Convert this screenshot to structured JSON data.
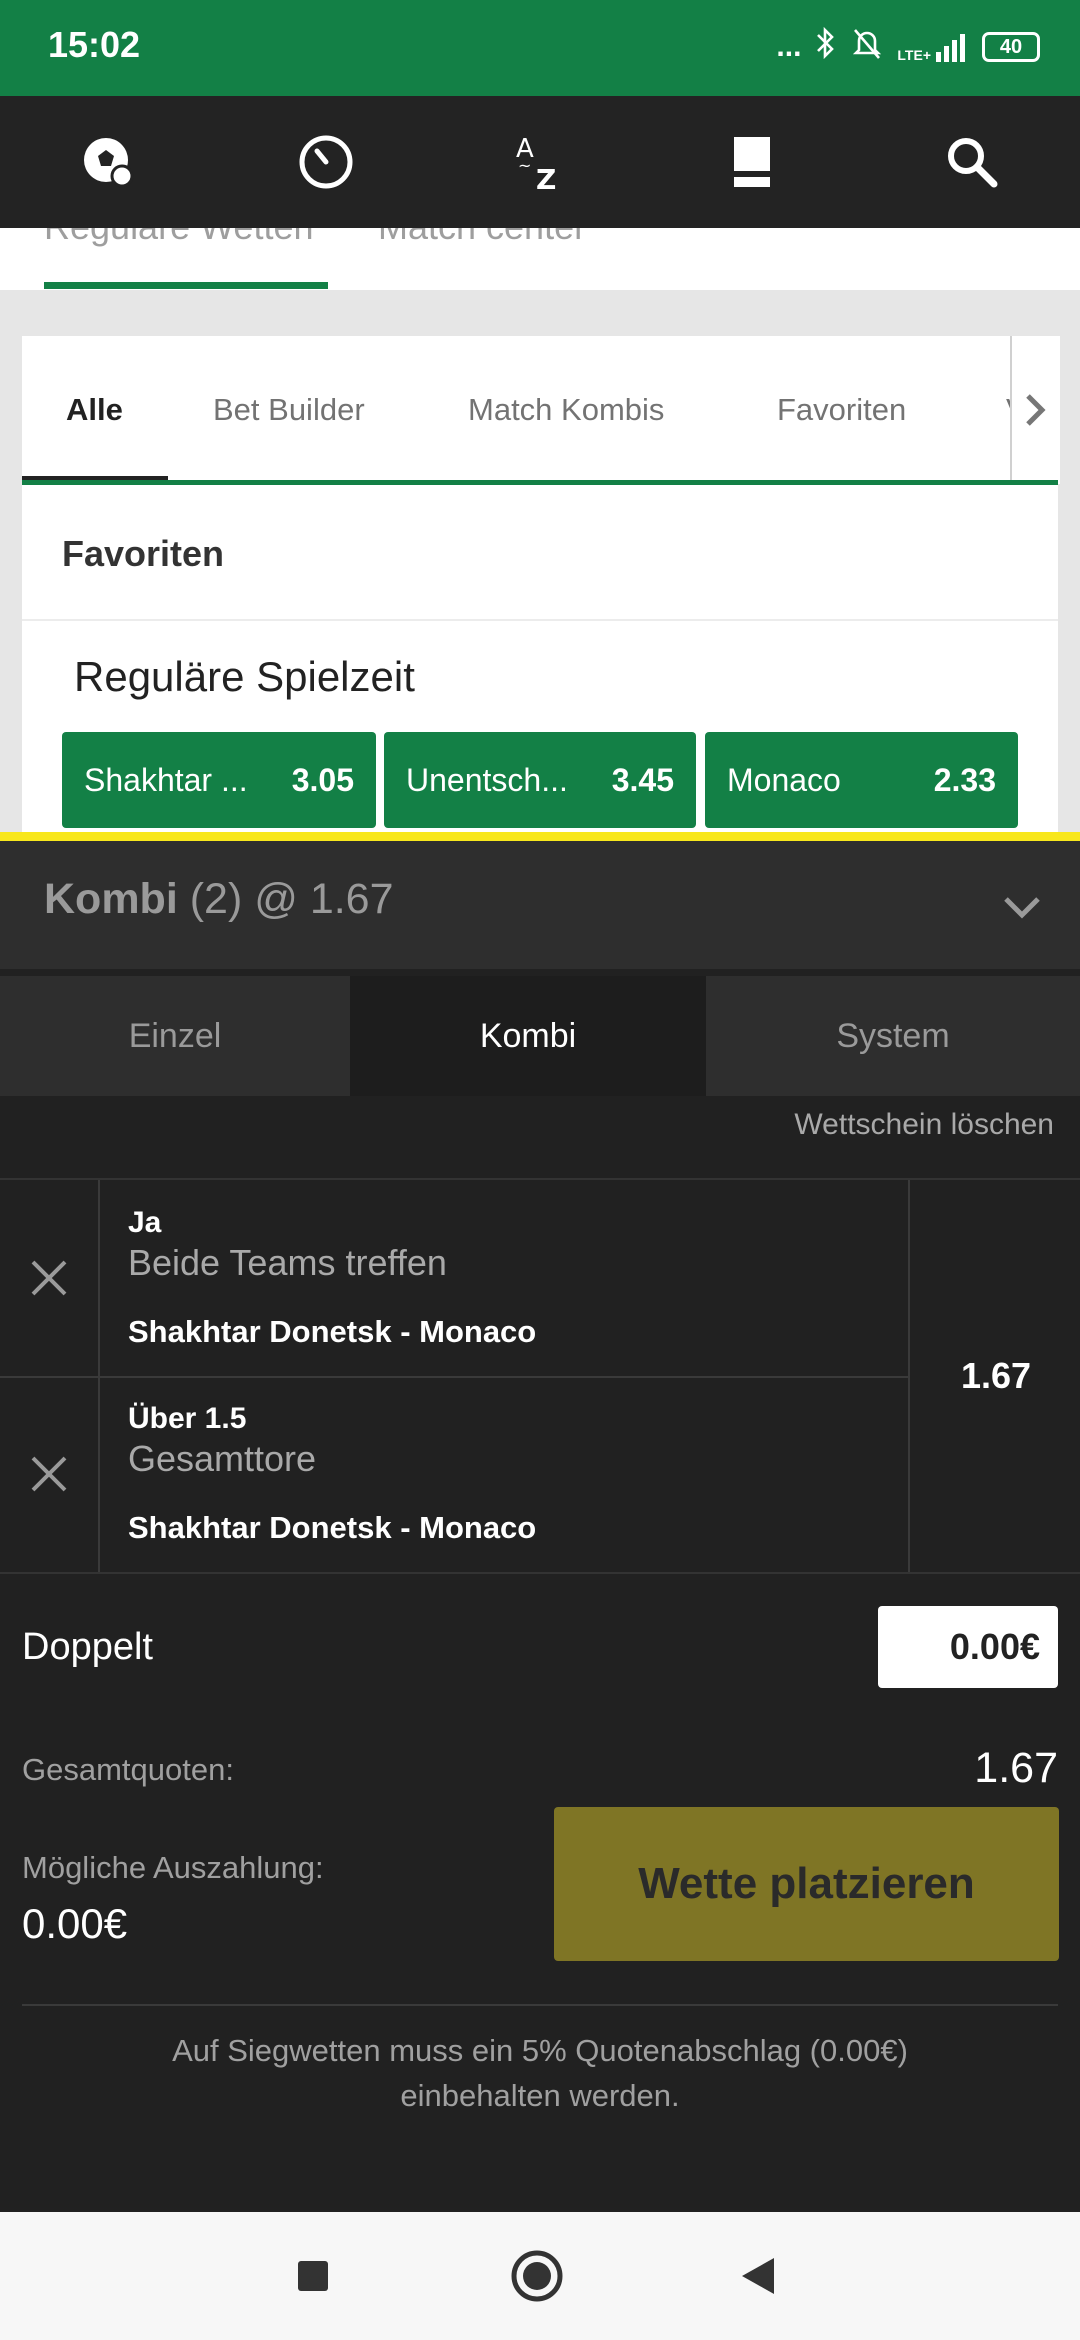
{
  "status_bar": {
    "time": "15:02",
    "signal_dots": "...",
    "network": "LTE+",
    "battery": "40"
  },
  "top_nav": {
    "icons": [
      "sports-ball-icon",
      "live-speedometer-icon",
      "a-z-icon",
      "betslip-icon",
      "search-icon"
    ]
  },
  "sub_tabs": [
    {
      "label": "Reguläre Wetten",
      "active": true
    },
    {
      "label": "Match center",
      "active": false
    }
  ],
  "filters": [
    {
      "label": "Alle",
      "active": true
    },
    {
      "label": "Bet Builder",
      "active": false
    },
    {
      "label": "Match Kombis",
      "active": false
    },
    {
      "label": "Favoriten",
      "active": false
    },
    {
      "label": "V",
      "active": false
    }
  ],
  "favorites": {
    "title": "Favoriten",
    "market_title": "Reguläre Spielzeit",
    "odds": [
      {
        "name": "Shakhtar ...",
        "value": "3.05"
      },
      {
        "name": "Unentsch...",
        "value": "3.45"
      },
      {
        "name": "Monaco",
        "value": "2.33"
      }
    ]
  },
  "betslip": {
    "title_bold": "Kombi",
    "title_rest": " (2) @ 1.67",
    "tabs": [
      {
        "label": "Einzel",
        "active": false
      },
      {
        "label": "Kombi",
        "active": true
      },
      {
        "label": "System",
        "active": false
      }
    ],
    "clear_label": "Wettschein löschen",
    "bets": [
      {
        "selection": "Ja",
        "market": "Beide Teams treffen",
        "match": "Shakhtar Donetsk - Monaco"
      },
      {
        "selection": "Über 1.5",
        "market": "Gesamttore",
        "match": "Shakhtar Donetsk - Monaco"
      }
    ],
    "combined_odds": "1.67",
    "stake_label": "Doppelt",
    "stake_value": "0.00€",
    "total_odds_label": "Gesamtquoten:",
    "total_odds_value": "1.67",
    "payout_label": "Mögliche Auszahlung:",
    "payout_value": "0.00€",
    "place_bet_label": "Wette platzieren",
    "note": "Auf Siegwetten muss ein 5% Quotenabschlag (0.00€) einbehalten werden."
  },
  "colors": {
    "brand_green": "#138046",
    "highlight_yellow": "#f8e71c",
    "place_button": "#7f7525"
  }
}
